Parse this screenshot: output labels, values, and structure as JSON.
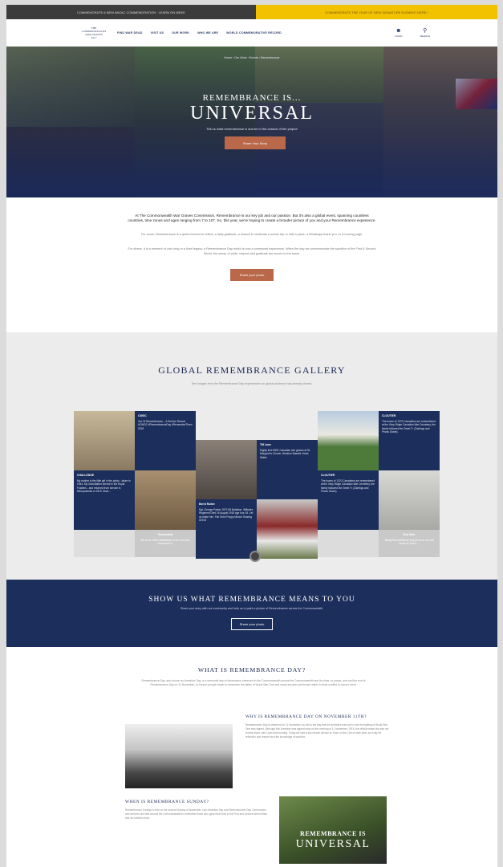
{
  "topbar": {
    "left_text": "COMMEMORATE A NEW ANZAC COMMEMORATION · LEARN ON WEEK",
    "right_text": "COMMEMORATE THE YEAR OF NEW SIGNATURE ELEMENT HERE ›"
  },
  "header": {
    "logo_lines": [
      "THE",
      "COMMONWEALTH",
      "WAR GRAVES",
      "1917"
    ],
    "nav": [
      "FIND WAR DEAD",
      "VISIT US",
      "OUR WORK",
      "WHO WE ARE",
      "WORLD COMMEMORATIVE RECORD"
    ],
    "icons": [
      {
        "icon": "user-icon",
        "label": "LOGIN"
      },
      {
        "icon": "search-icon",
        "label": "SEARCH"
      }
    ]
  },
  "hero": {
    "breadcrumb": "Home  ›  Our Work  ›  Events  ›  Remembrance",
    "title_small": "REMEMBRANCE IS...",
    "title_big": "UNIVERSAL",
    "subtitle": "Tell us what remembrance is and be in the chance of the project",
    "button": "Share Your Story"
  },
  "intro": {
    "lead": "At The Commonwealth War Graves Commission, Remembrance is our key job and our passion. But it's also a global event, spanning countless countries, time zones and ages ranging from 7 to 107. So, this year, we're hoping to create a broader picture of you and your Remembrance experience.",
    "p1": "For some, Remembrance is a quiet moment to reflect, a daily gratitude, a chance to celebrate a school trip or visit a place, a Whatsapp thank you, or a moving page.",
    "p2": "For others, it is a moment of civic duty or a lived legacy; a Remembrance Day which is now a communal experience. When the day we commemorate the sacrifice of the First & Second World, the sense of pride, respect and gratitude are woven in the same.",
    "button": "Share your photo"
  },
  "gallery": {
    "title": "GLOBAL REMEMBRANCE GALLERY",
    "subtitle": "See images from the Remembrance Day experiences our global audience has already shared.",
    "tiles": [
      {
        "head": "CWGC",
        "body": "Our St Remembrance... A Service Record #CWGC #RemembranceDay #RememberThem 2018"
      },
      {
        "head": "CHALLENGE",
        "body": "My mother is the little girl in the photo - taken in 1944. My Grandfather served in the Royal Fusiliers - and returned from service in Mesopotamia in 1919. Mum..."
      },
      {
        "head": "Bernt Rutter",
        "body": "Sgt. George Parker 1972-98 Battalion, Wiltshire Regiment Died 16 August 1918 age four 18. Let us make him. Fair Shed Poppy Munch Sharing #1918"
      },
      {
        "head": "TM Lane",
        "body": "Eighty first WW1 Canadian war graves at St. Margaret's Church, Wootton Bassett, Herts Wales"
      },
      {
        "head": "CLOUTIER",
        "body": "The boxes of 1370 Canadians are remembered at the Vimy Ridge Canadian War Cemetery, the family followed the Great Tr. (Darlings and Privas Grave)."
      },
      {
        "head": "CLOUTIER",
        "body": "The boxes of 1370 Canadians are remembered at the Vimy Ridge Canadian War Cemetery, the family followed the Great Tr. (Darlings and Privas Grave)."
      },
      {
        "head": "Thamesdale",
        "body": "We at the WW1 Battlefields of our local and remembered."
      },
      {
        "head": "Red lilies",
        "body": "Taking Remembrance Day photo at my new home of Grand ..."
      }
    ]
  },
  "showus": {
    "title": "SHOW US WHAT REMEMBRANCE MEANS TO YOU",
    "subtitle": "Share your story with our community and help us to paint a picture of Remembrance across the Commonwealth.",
    "button": "Share your photo"
  },
  "what": {
    "title": "WHAT IS REMEMBRANCE DAY?",
    "para": "Remembrance Day, also known as Armistice Day, is a memorial day of observance observed in the Commonwealth across the Commonwealth and its close, to pause, and and the end of Remembrance Day on 11 November, to honour people relate to remember the fallen of World War One and many services performed within it since conflict to honour them.",
    "s1_title": "WHY IS REMEMBRANCE DAY ON NOVEMBER 11TH?",
    "s1_text": "Remembrance Day is observed on 11 November, as this is the day that the Armistice was put to end the fighting of World War One was signed. Although this Armistice was signed early on the morning of 11 November, 1918, the official cease-fire was not to take place until 11am that morning. Today we hold a two minute silence at 11am on the 11th of each year, as a day for reflection and respect and the knowledge of sacrifice.",
    "s2_title": "WHEN IS REMEMBRANCE SUNDAY?",
    "s2_text": "Remembrance Sunday is held on the second Sunday of November. Like Armistice Day and Remembrance Day, Ceremonies and services are held around the Commonwealth to remember those who gave their lives in the First and Second World Wars and all conflicts since.",
    "promo_line1": "REMEMBRANCE IS",
    "promo_line2": "UNIVERSAL"
  }
}
